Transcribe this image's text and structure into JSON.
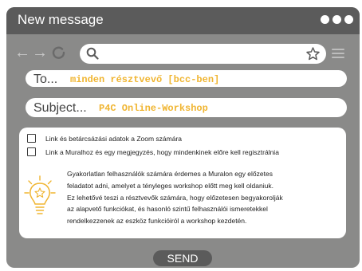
{
  "window": {
    "title": "New message"
  },
  "toolbar": {
    "back_icon": "arrow-left-icon",
    "forward_icon": "arrow-right-icon",
    "reload_icon": "reload-icon",
    "search_icon": "search-icon",
    "bookmark_icon": "star-icon",
    "menu_icon": "hamburger-menu-icon"
  },
  "fields": {
    "to": {
      "label": "To...",
      "value": "minden résztvevő [bcc-ben]"
    },
    "subject": {
      "label": "Subject...",
      "value": "P4C Online-Workshop"
    }
  },
  "body": {
    "checklist": [
      {
        "label": "Link és betárcsázási adatok a Zoom számára",
        "checked": false
      },
      {
        "label": "Link a Muralhoz és egy megjegyzés, hogy mindenkinek előre kell regisztrálnia",
        "checked": false
      }
    ],
    "tip_icon": "lightbulb-star-icon",
    "tip_lines": [
      "Gyakorlatlan felhasználók számára érdemes a Muralon egy előzetes",
      "feladatot adni, amelyet a tényleges workshop előtt meg kell oldaniuk.",
      "Ez lehetővé teszi a résztvevők számára, hogy előzetesen begyakorolják",
      "az alapvető funkciókat, és hasonló szintű felhasználói ismeretekkel",
      "rendelkezzenek az eszköz funkcióiról a workshop kezdetén."
    ]
  },
  "send_label": "SEND",
  "colors": {
    "accent": "#f0b531",
    "titlebar": "#5b5b5b",
    "window": "#8a8a89"
  }
}
